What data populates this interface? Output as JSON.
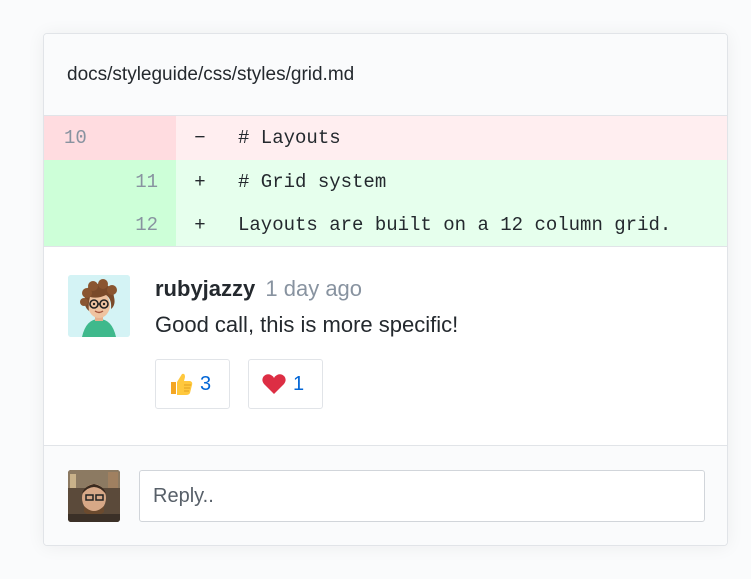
{
  "file": {
    "path": "docs/styleguide/css/styles/grid.md"
  },
  "diff": {
    "lines": [
      {
        "old": "10",
        "new": "",
        "sign": "−",
        "code": "# Layouts",
        "kind": "removed"
      },
      {
        "old": "",
        "new": "11",
        "sign": "+",
        "code": "# Grid system",
        "kind": "added"
      },
      {
        "old": "",
        "new": "12",
        "sign": "+",
        "code": "Layouts are built on a 12 column grid.",
        "kind": "added"
      }
    ]
  },
  "comment": {
    "author": "rubyjazzy",
    "time": "1 day ago",
    "text": "Good call, this is more specific!",
    "reactions": [
      {
        "emoji": "thumbs-up-icon",
        "count": "3"
      },
      {
        "emoji": "heart-icon",
        "count": "1"
      }
    ]
  },
  "reply": {
    "placeholder": "Reply.."
  },
  "colors": {
    "removed_bg": "#ffeef0",
    "added_bg": "#e6ffed",
    "link": "#0366d6"
  }
}
